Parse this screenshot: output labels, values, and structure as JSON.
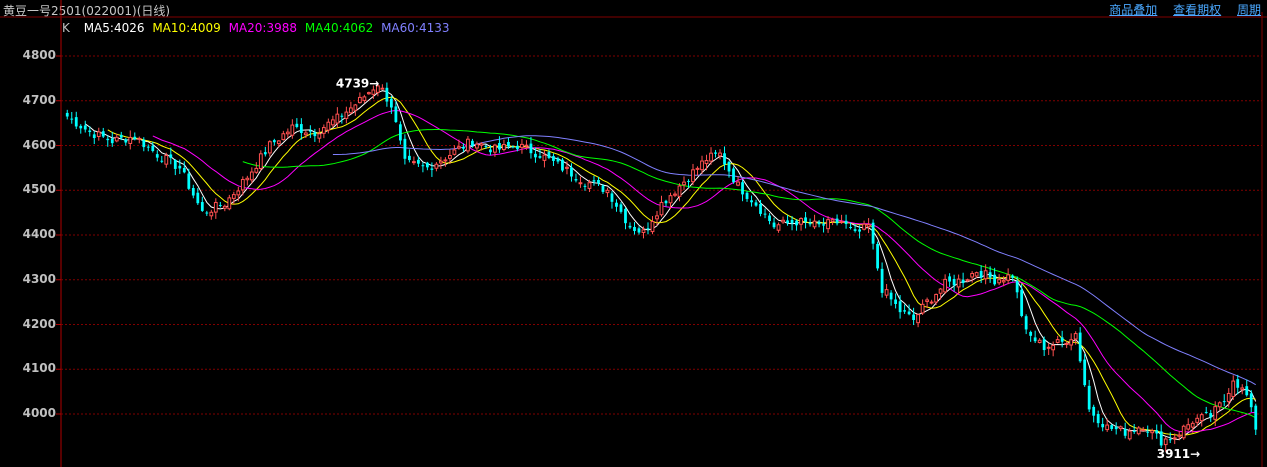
{
  "header": {
    "title": "黄豆一号2501(022001)(日线)",
    "links": [
      "商品叠加",
      "查看期权",
      "周期"
    ]
  },
  "legend": {
    "k": "K",
    "items": [
      {
        "text": "MA5:4026",
        "color": "#ffffff"
      },
      {
        "text": "MA10:4009",
        "color": "#ffff00"
      },
      {
        "text": "MA20:3988",
        "color": "#ff00ff"
      },
      {
        "text": "MA40:4062",
        "color": "#00ff00"
      },
      {
        "text": "MA60:4133",
        "color": "#8080ff"
      }
    ]
  },
  "colors": {
    "up": "#ff5050",
    "down": "#00ffff",
    "grid": "#800000",
    "axis": "#b00000"
  },
  "annotations": {
    "high": "4739",
    "low": "3911"
  },
  "chart_data": {
    "type": "candlestick",
    "ylim": [
      3890,
      4850
    ],
    "yticks": [
      4000,
      4100,
      4200,
      4300,
      4400,
      4500,
      4600,
      4700,
      4800
    ],
    "anchor_points": [
      [
        0,
        4665
      ],
      [
        5,
        4630
      ],
      [
        10,
        4610
      ],
      [
        15,
        4620
      ],
      [
        20,
        4580
      ],
      [
        25,
        4550
      ],
      [
        30,
        4450
      ],
      [
        35,
        4470
      ],
      [
        40,
        4530
      ],
      [
        45,
        4600
      ],
      [
        50,
        4640
      ],
      [
        55,
        4630
      ],
      [
        60,
        4660
      ],
      [
        65,
        4700
      ],
      [
        69,
        4739
      ],
      [
        72,
        4690
      ],
      [
        75,
        4560
      ],
      [
        80,
        4550
      ],
      [
        85,
        4580
      ],
      [
        90,
        4610
      ],
      [
        95,
        4590
      ],
      [
        100,
        4600
      ],
      [
        105,
        4580
      ],
      [
        110,
        4550
      ],
      [
        115,
        4520
      ],
      [
        120,
        4500
      ],
      [
        125,
        4420
      ],
      [
        128,
        4405
      ],
      [
        132,
        4470
      ],
      [
        137,
        4520
      ],
      [
        142,
        4570
      ],
      [
        145,
        4580
      ],
      [
        149,
        4510
      ],
      [
        153,
        4470
      ],
      [
        157,
        4420
      ],
      [
        162,
        4430
      ],
      [
        167,
        4420
      ],
      [
        172,
        4430
      ],
      [
        175,
        4400
      ],
      [
        178,
        4420
      ],
      [
        181,
        4280
      ],
      [
        185,
        4230
      ],
      [
        188,
        4210
      ],
      [
        191,
        4250
      ],
      [
        195,
        4290
      ],
      [
        199,
        4300
      ],
      [
        202,
        4320
      ],
      [
        206,
        4300
      ],
      [
        210,
        4310
      ],
      [
        213,
        4180
      ],
      [
        217,
        4150
      ],
      [
        221,
        4160
      ],
      [
        224,
        4180
      ],
      [
        227,
        4010
      ],
      [
        231,
        3970
      ],
      [
        235,
        3960
      ],
      [
        239,
        3975
      ],
      [
        243,
        3940
      ],
      [
        246,
        3950
      ],
      [
        250,
        3985
      ],
      [
        254,
        3995
      ],
      [
        257,
        4030
      ],
      [
        259,
        4080
      ],
      [
        262,
        4040
      ],
      [
        264,
        3970
      ]
    ],
    "total_bars": 265
  }
}
